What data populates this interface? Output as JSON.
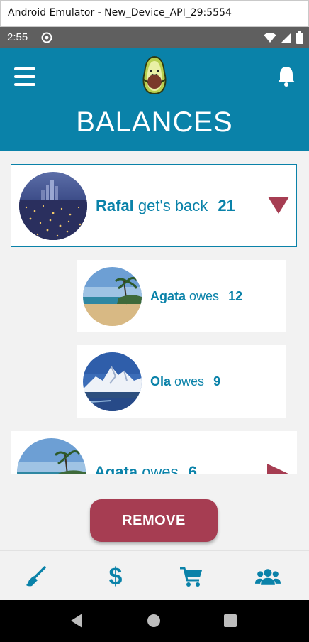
{
  "window": {
    "title": "Android Emulator - New_Device_API_29:5554"
  },
  "status_bar": {
    "time": "2:55"
  },
  "app_bar": {
    "title": "BALANCES",
    "logo": "avocado-icon",
    "menu_icon": "menu-icon",
    "notification_icon": "bell-icon"
  },
  "balances": {
    "main": {
      "name": "Rafal",
      "verb": "get's back",
      "amount": "21",
      "expanded": true
    },
    "children": [
      {
        "name": "Agata",
        "verb": "owes",
        "amount": "12"
      },
      {
        "name": "Ola",
        "verb": "owes",
        "amount": "9"
      }
    ],
    "next": {
      "name": "Agata",
      "verb": "owes",
      "amount": "6",
      "expanded": false
    }
  },
  "actions": {
    "remove_label": "REMOVE"
  },
  "bottom_nav": [
    {
      "icon": "broom-icon"
    },
    {
      "icon": "dollar-icon",
      "glyph": "$"
    },
    {
      "icon": "cart-icon"
    },
    {
      "icon": "group-icon"
    }
  ],
  "colors": {
    "primary": "#0a82a9",
    "accent": "#a63d52",
    "background": "#f2f2f2"
  }
}
